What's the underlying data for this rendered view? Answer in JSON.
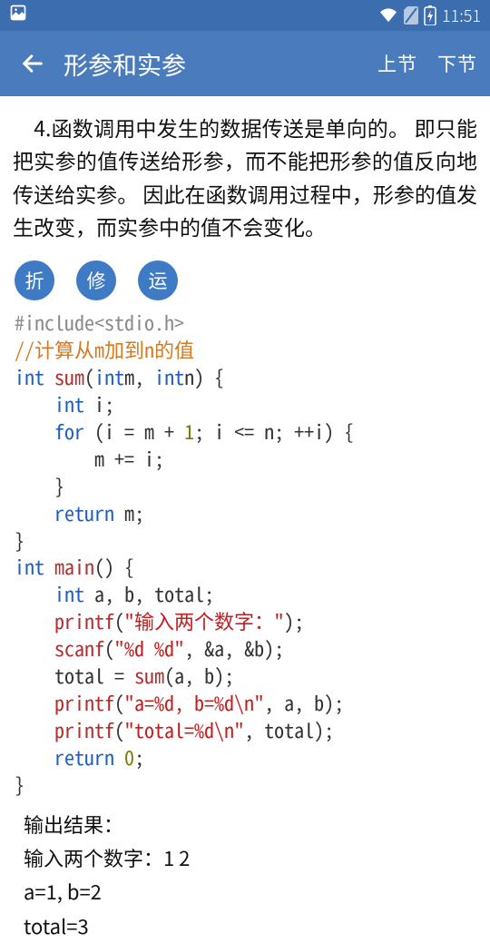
{
  "status": {
    "time": "11:51"
  },
  "header": {
    "title": "形参和实参",
    "prev": "上节",
    "next": "下节"
  },
  "paragraph": "　4.函数调用中发生的数据传送是单向的。 即只能把实参的值传送给形参，而不能把形参的值反向地传送给实参。 因此在函数调用过程中，形参的值发生改变，而实参中的值不会变化。",
  "buttons": {
    "fold": "折",
    "fix": "修",
    "run": "运"
  },
  "code": {
    "include": "#include<stdio.h>",
    "comment": "//计算从m加到n的值",
    "kw_int": "int",
    "kw_for": "for",
    "kw_return": "return",
    "fn_sum": "sum",
    "fn_main": "main",
    "fn_printf": "printf",
    "fn_scanf": "scanf",
    "str_prompt": "\"输入两个数字：\"",
    "str_fmt_read": "\"%d %d\"",
    "str_ab": "\"a=%d, b=%d\\n\"",
    "str_total": "\"total=%d\\n\"",
    "num_1": "1",
    "num_0": "0"
  },
  "output": {
    "label": "输出结果：",
    "line1": "输入两个数字：1 2",
    "line2": "a=1, b=2",
    "line3": "total=3"
  }
}
